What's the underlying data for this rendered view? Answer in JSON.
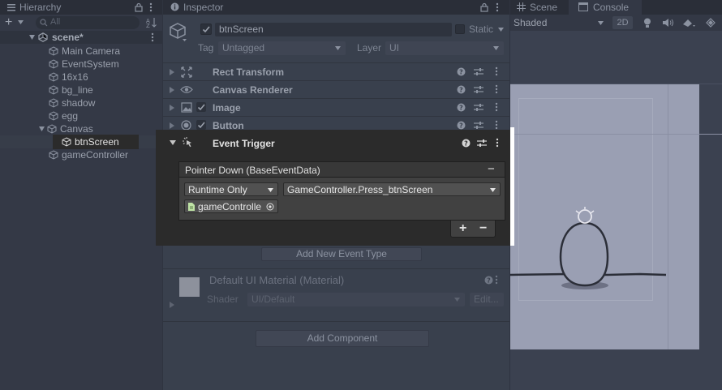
{
  "hierarchy": {
    "tab_label": "Hierarchy",
    "add_label": "+",
    "search_placeholder": "All",
    "scene_name": "scene*",
    "items": [
      "Main Camera",
      "EventSystem",
      "16x16",
      "bg_line",
      "shadow",
      "egg",
      "Canvas",
      "btnScreen",
      "gameController"
    ]
  },
  "inspector": {
    "tab_label": "Inspector",
    "object_name": "btnScreen",
    "static_label": "Static",
    "tag_label": "Tag",
    "tag_value": "Untagged",
    "layer_label": "Layer",
    "layer_value": "UI",
    "components": [
      "Rect Transform",
      "Canvas Renderer",
      "Image",
      "Button",
      "Event Trigger"
    ],
    "add_event_type": "Add New Event Type",
    "material_title": "Default UI Material (Material)",
    "shader_label": "Shader",
    "shader_value": "UI/Default",
    "edit_label": "Edit...",
    "add_component": "Add Component"
  },
  "event_trigger": {
    "event_name": "Pointer Down (BaseEventData)",
    "runtime_option": "Runtime Only",
    "function": "GameController.Press_btnScreen",
    "target_object": "gameControlle",
    "add_label": "+",
    "remove_label": "−",
    "remove_event_label": "−"
  },
  "scene": {
    "scene_tab": "Scene",
    "console_tab": "Console",
    "shading_mode": "Shaded",
    "mode_2d": "2D"
  },
  "colors": {
    "panel": "#343946",
    "inspector": "#39404d",
    "overlay": "#2b2b2b",
    "scene_canvas": "#9a9fb3"
  }
}
